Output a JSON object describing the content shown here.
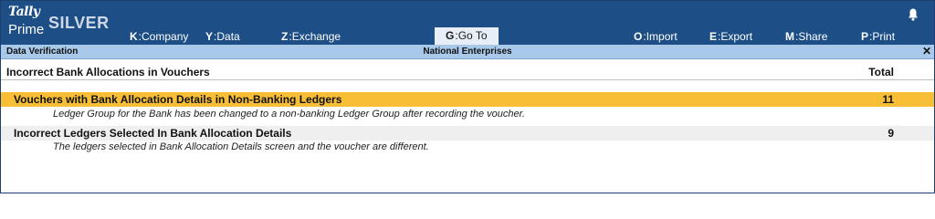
{
  "app": {
    "logo_top": "Tally",
    "logo_bottom": "Prime",
    "edition": "SILVER"
  },
  "menu": [
    {
      "key": "K",
      "label": "Company"
    },
    {
      "key": "Y",
      "label": "Data"
    },
    {
      "key": "Z",
      "label": "Exchange"
    },
    {
      "key": "G",
      "label": "Go To"
    },
    {
      "key": "O",
      "label": "Import"
    },
    {
      "key": "E",
      "label": "Export"
    },
    {
      "key": "M",
      "label": "Share"
    },
    {
      "key": "P",
      "label": "Print"
    }
  ],
  "infobar": {
    "screen": "Data Verification",
    "company": "National Enterprises",
    "close": "✕"
  },
  "report": {
    "title": "Incorrect Bank Allocations in Vouchers",
    "total_header": "Total",
    "items": [
      {
        "label": "Vouchers with Bank Allocation Details in Non-Banking Ledgers",
        "count": "11",
        "description": "Ledger Group for the Bank has been changed to a non-banking Ledger Group after recording the voucher."
      },
      {
        "label": "Incorrect Ledgers Selected In Bank Allocation Details",
        "count": "9",
        "description": "The ledgers selected in Bank Allocation Details screen and the voucher are different."
      }
    ]
  },
  "icons": {
    "notification": "bell-icon"
  },
  "colors": {
    "topbar": "#1d4f86",
    "infobar": "#a8c9ea",
    "selected_row": "#f7be36",
    "row_grey": "#efefef"
  }
}
